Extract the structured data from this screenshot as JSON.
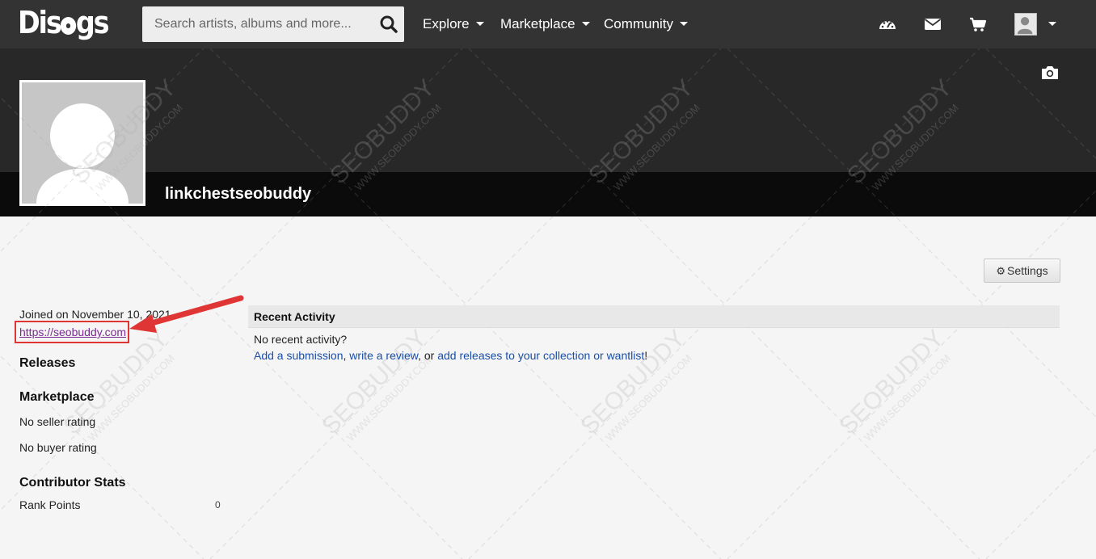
{
  "nav": {
    "logo": "Discogs",
    "search_placeholder": "Search artists, albums and more...",
    "menus": [
      "Explore",
      "Marketplace",
      "Community"
    ],
    "icons": [
      "dashboard-icon",
      "envelope-icon",
      "cart-icon",
      "user-avatar"
    ]
  },
  "profile": {
    "username": "linkchestseobuddy",
    "joined": "Joined on November 10, 2021",
    "website": "https://seobuddy.com"
  },
  "settings_label": "Settings",
  "sidebar": {
    "releases_heading": "Releases",
    "marketplace_heading": "Marketplace",
    "seller_rating": "No seller rating",
    "buyer_rating": "No buyer rating",
    "contributor_heading": "Contributor Stats",
    "rank_points_label": "Rank Points",
    "rank_points_value": "0"
  },
  "activity": {
    "title": "Recent Activity",
    "empty": "No recent activity?",
    "link_submission": "Add a submission",
    "link_review": "write a review",
    "link_collection": "add releases to your collection or wantlist",
    "sep1": ", ",
    "sep2": ", or ",
    "end": "!"
  },
  "watermark": "SEOBUDDY",
  "watermark_sub": "WWW.SEOBUDDY.COM",
  "colors": {
    "nav_bg": "#333333",
    "banner_bg": "#282828",
    "namebar_bg": "#0b0b0b",
    "link": "#1a4ea8",
    "visited_link": "#7b2c91",
    "highlight": "#e03535"
  }
}
